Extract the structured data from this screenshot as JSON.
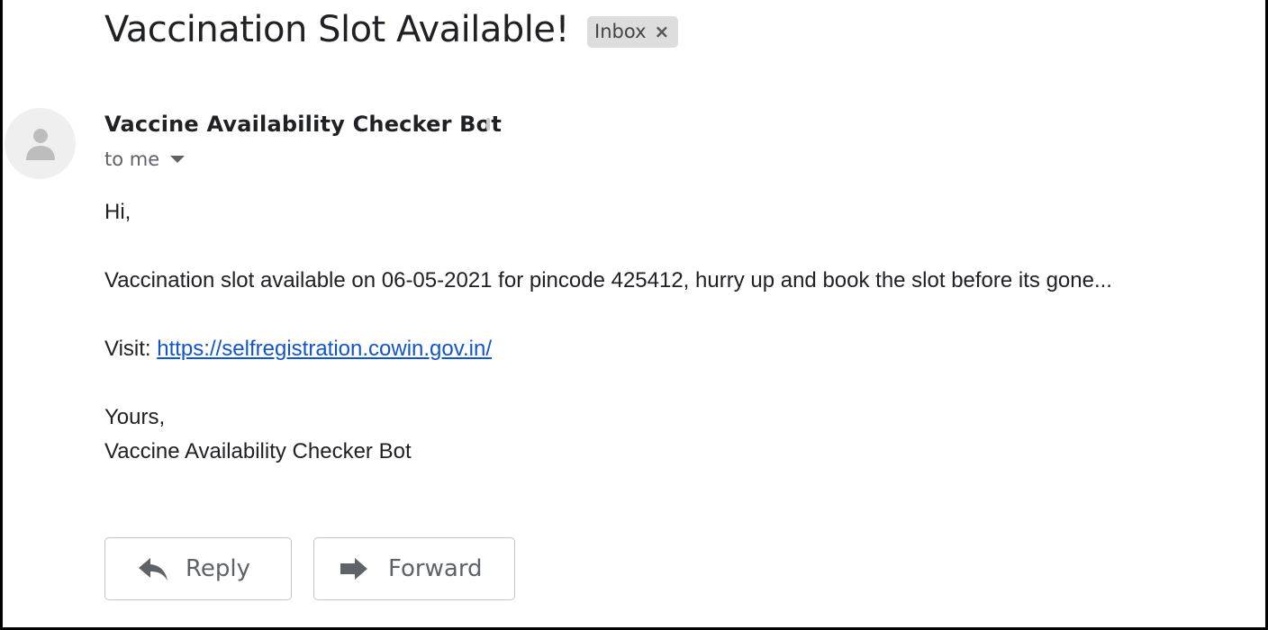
{
  "email": {
    "subject": "Vaccination Slot Available!",
    "label": "Inbox",
    "label_remove": "×",
    "sender": "Vaccine Availability Checker Bot",
    "recipient": "to me",
    "greeting": "Hi,",
    "message": "Vaccination slot available on 06-05-2021 for pincode 425412, hurry up and book the slot before its gone...",
    "visit_prefix": "Visit: ",
    "link": "https://selfregistration.cowin.gov.in/",
    "closing": "Yours,",
    "signature": "Vaccine Availability Checker Bot"
  },
  "actions": {
    "reply_label": "Reply",
    "forward_label": "Forward"
  },
  "icons": {
    "avatar": "person-icon",
    "recipient_details": "dropdown-arrow-icon",
    "reply": "reply-arrow-icon",
    "forward": "forward-arrow-icon"
  },
  "colors": {
    "text": "#202124",
    "secondary_text": "#5f6368",
    "link": "#1155cc",
    "chip_background": "#dddddd",
    "button_border": "#c4c4c4"
  }
}
